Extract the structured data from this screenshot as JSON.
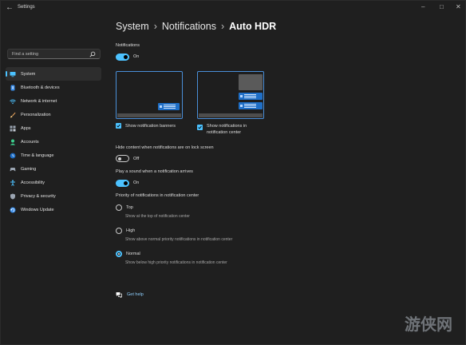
{
  "window": {
    "title": "Settings",
    "back_icon": "back-arrow-icon"
  },
  "search": {
    "placeholder": "Find a setting"
  },
  "sidebar": {
    "items": [
      {
        "label": "System",
        "icon": "monitor-icon",
        "color": "#4cc2ff",
        "active": true
      },
      {
        "label": "Bluetooth & devices",
        "icon": "bluetooth-icon",
        "color": "#3b8eea"
      },
      {
        "label": "Network & internet",
        "icon": "wifi-icon",
        "color": "#4cc2ff"
      },
      {
        "label": "Personalization",
        "icon": "brush-icon",
        "color": "#e8a25a"
      },
      {
        "label": "Apps",
        "icon": "apps-icon",
        "color": "#9aa4b1"
      },
      {
        "label": "Accounts",
        "icon": "person-icon",
        "color": "#3ccf8e"
      },
      {
        "label": "Time & language",
        "icon": "globe-clock-icon",
        "color": "#4cc2ff"
      },
      {
        "label": "Gaming",
        "icon": "gamepad-icon",
        "color": "#9aa4b1"
      },
      {
        "label": "Accessibility",
        "icon": "accessibility-icon",
        "color": "#4cc2ff"
      },
      {
        "label": "Privacy & security",
        "icon": "shield-icon",
        "color": "#9aa4b1"
      },
      {
        "label": "Windows Update",
        "icon": "update-icon",
        "color": "#3b8eea"
      }
    ]
  },
  "breadcrumb": {
    "items": [
      "System",
      "Notifications",
      "Auto HDR"
    ]
  },
  "main": {
    "notifications_label": "Notifications",
    "notifications_toggle": "On",
    "show_banners": "Show notification banners",
    "show_in_center_line1": "Show notifications in",
    "show_in_center_line2": "notification center",
    "hide_content_label": "Hide content when notifications are on lock screen",
    "hide_content_toggle": "Off",
    "play_sound_label": "Play a sound when a notification arrives",
    "play_sound_toggle": "On",
    "priority_label": "Priority of notifications in notification center",
    "priority_options": [
      {
        "label": "Top",
        "desc": "Show at the top of notification center",
        "selected": false
      },
      {
        "label": "High",
        "desc": "Show above normal priority notifications in notification center",
        "selected": false
      },
      {
        "label": "Normal",
        "desc": "Show below high priority notifications in notification center",
        "selected": true
      }
    ],
    "get_help": "Get help"
  },
  "watermark": "游侠网",
  "colors": {
    "accent": "#4cc2ff",
    "background": "#1f1f1f"
  }
}
